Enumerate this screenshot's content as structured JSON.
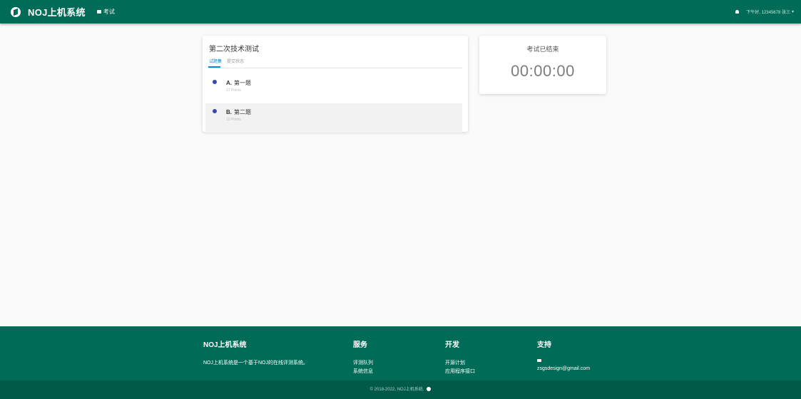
{
  "navbar": {
    "brand": "NOJ上机系统",
    "exam_link": "考试",
    "user_greeting": "下午好, 12345678 张三",
    "icons": {
      "logo": "noj-logo",
      "exam": "chat-icon",
      "bell": "bell-icon",
      "caret": "chevron-down-icon"
    }
  },
  "exam": {
    "title": "第二次技术测试",
    "tabs": [
      {
        "label": "试题集",
        "active": true
      },
      {
        "label": "提交状态",
        "active": false
      }
    ],
    "problems": [
      {
        "index": "A.",
        "name": "第一题",
        "points": "17 Points"
      },
      {
        "index": "B.",
        "name": "第二题",
        "points": "10 Points"
      }
    ]
  },
  "timer": {
    "status": "考试已结束",
    "clock": "00:00:00"
  },
  "footer": {
    "about": {
      "title": "NOJ上机系统",
      "text": "NOJ上机系统是一个基于NOJ的在线评测系统。"
    },
    "service": {
      "title": "服务",
      "links": [
        "评测队列",
        "系统信息"
      ]
    },
    "develop": {
      "title": "开发",
      "links": [
        "开源计划",
        "应用程序接口"
      ]
    },
    "support": {
      "title": "支持",
      "email": "zsgsdesign@gmail.com"
    },
    "copyright": "© 2018-2022, NOJ上机系统."
  },
  "colors": {
    "primary": "#006b56",
    "bottom_bar": "#015947",
    "accent": "#0288d1",
    "dot": "#3949ab"
  }
}
